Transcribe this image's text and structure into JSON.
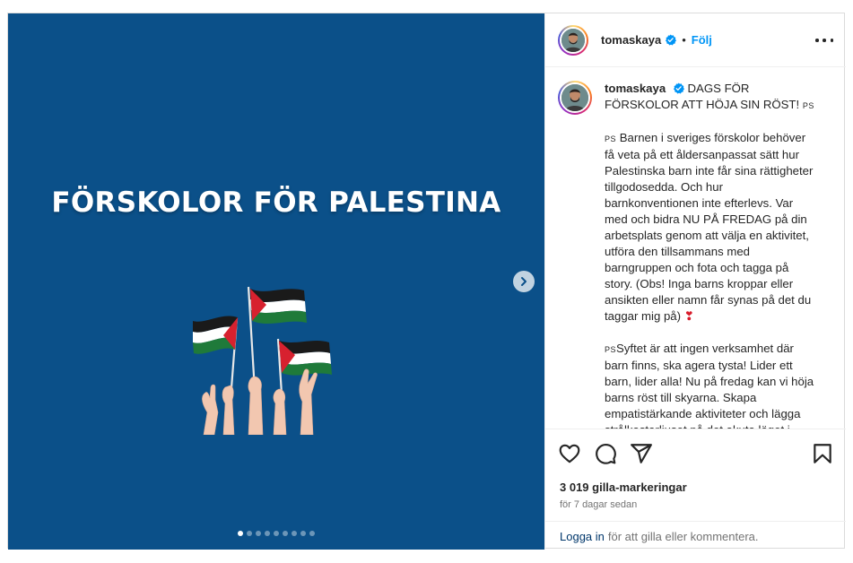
{
  "colors": {
    "media_background": "#0b5089",
    "accent_blue": "#0095f6",
    "link_dark": "#00376b",
    "muted": "#737373",
    "text": "#262626"
  },
  "media": {
    "title": "FÖRSKOLOR FÖR PALESTINA",
    "illustration_icon": "palestine-flags-hands-illustration",
    "next_icon": "chevron-right-icon",
    "carousel": {
      "total": 9,
      "active": 1
    }
  },
  "header": {
    "username": "tomaskaya",
    "verified_icon": "verified-badge-icon",
    "separator": "•",
    "follow_label": "Följ",
    "more_icon": "more-horizontal-icon"
  },
  "caption": {
    "username": "tomaskaya",
    "headline": "DAGS FÖR FÖRSKOLOR ATT HÖJA SIN RÖST!",
    "ps_marker": "PS",
    "para1": "Barnen i sveriges förskolor behöver få veta på ett åldersanpassat sätt hur Palestinska barn inte får sina rättigheter tillgodosedda. Och hur barnkonventionen inte efterlevs. Var med och bidra NU PÅ FREDAG på din arbetsplats genom att välja en aktivitet, utföra den tillsammans med barngruppen och fota och tagga på story. (Obs! Inga barns kroppar eller ansikten eller namn får synas på det du taggar mig på)",
    "para1_emoji": "❣",
    "para2": "Syftet är att ingen verksamhet där barn finns, ska agera tysta! Lider ett barn, lider alla! Nu på fredag kan vi höja barns röst till skyarna. Skapa empatistärkande aktiviteter och lägga strålkastarljuset på det akuta läget i"
  },
  "actions": {
    "like_icon": "heart-icon",
    "comment_icon": "comment-icon",
    "share_icon": "send-icon",
    "save_icon": "bookmark-icon",
    "likes_text": "3 019 gilla-markeringar",
    "time_text": "för 7 dagar sedan",
    "login_link": "Logga in",
    "login_rest": "för att gilla eller kommentera."
  }
}
